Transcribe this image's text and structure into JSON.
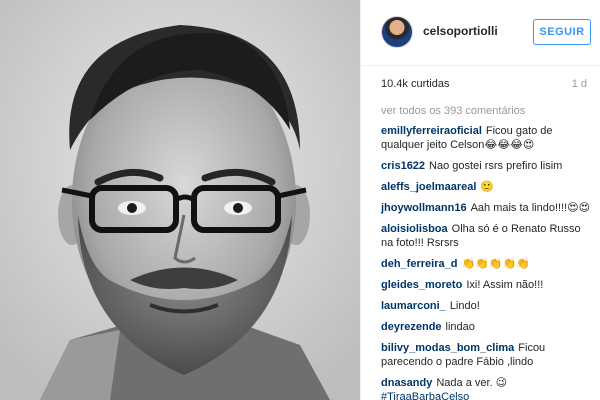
{
  "post": {
    "username": "celsoportiolli",
    "follow_label": "SEGUIR",
    "likes": "10.4k curtidas",
    "time": "1 d",
    "view_all": "ver todos os 393 comentários"
  },
  "comments": [
    {
      "user": "emillyferreiraoficial",
      "text": "Ficou gato de qualquer jeito Celson😂😂😂😍"
    },
    {
      "user": "cris1622",
      "text": "Nao gostei rsrs prefiro lisim"
    },
    {
      "user": "aleffs_joelmaareal",
      "text": "🙂"
    },
    {
      "user": "jhoywollmann16",
      "text": "Aah mais ta lindo!!!!😍😍"
    },
    {
      "user": "aloisiolisboa",
      "text": "Olha só é o Renato Russo na foto!!! Rsrsrs"
    },
    {
      "user": "deh_ferreira_d",
      "text": "👏👏👏👏👏"
    },
    {
      "user": "gleides_moreto",
      "text": "Ixi! Assim não!!!"
    },
    {
      "user": "laumarconi_",
      "text": "Lindo!"
    },
    {
      "user": "deyrezende",
      "text": "lindao"
    },
    {
      "user": "bilivy_modas_bom_clima",
      "text": "Ficou parecendo o padre Fábio ,lindo"
    },
    {
      "user": "dnasandy",
      "text": "Nada a ver. 😉"
    }
  ],
  "hashtag": "#TiraaBarbaCelso",
  "icons": {
    "avatar": "profile-avatar",
    "photo": "portrait-photo"
  },
  "colors": {
    "accent": "#3897f0",
    "username": "#003569",
    "muted": "#999999"
  }
}
